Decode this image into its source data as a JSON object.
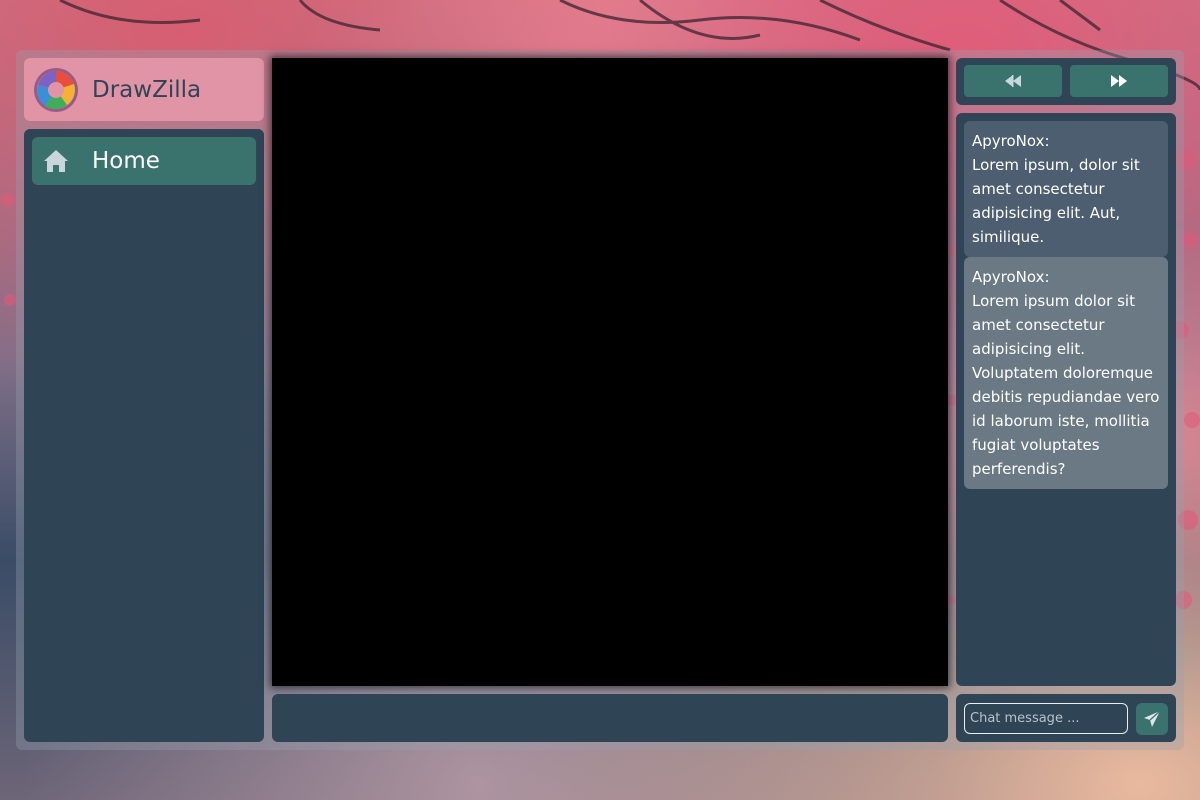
{
  "app": {
    "name": "DrawZilla"
  },
  "sidebar": {
    "items": [
      {
        "label": "Home",
        "icon": "home-icon",
        "active": true
      }
    ]
  },
  "controls": {
    "prev_icon": "rewind-icon",
    "next_icon": "fast-forward-icon"
  },
  "chat": {
    "messages": [
      {
        "author": "ApyroNox:",
        "text": "Lorem ipsum, dolor sit amet consectetur adipisicing elit. Aut, similique."
      },
      {
        "author": "ApyroNox:",
        "text": "Lorem ipsum dolor sit amet consectetur adipisicing elit. Voluptatem doloremque debitis repudiandae vero id laborum iste, mollitia fugiat voluptates perferendis?"
      }
    ],
    "input_placeholder": "Chat message ...",
    "input_value": "",
    "send_icon": "send-icon"
  },
  "colors": {
    "logo_bg": "#e194a6",
    "panel_bg": "#2f4455",
    "accent": "#3a736e",
    "canvas_bg": "#000000",
    "message_bg_1": "#4d5e70",
    "message_bg_2": "#6b7985"
  }
}
